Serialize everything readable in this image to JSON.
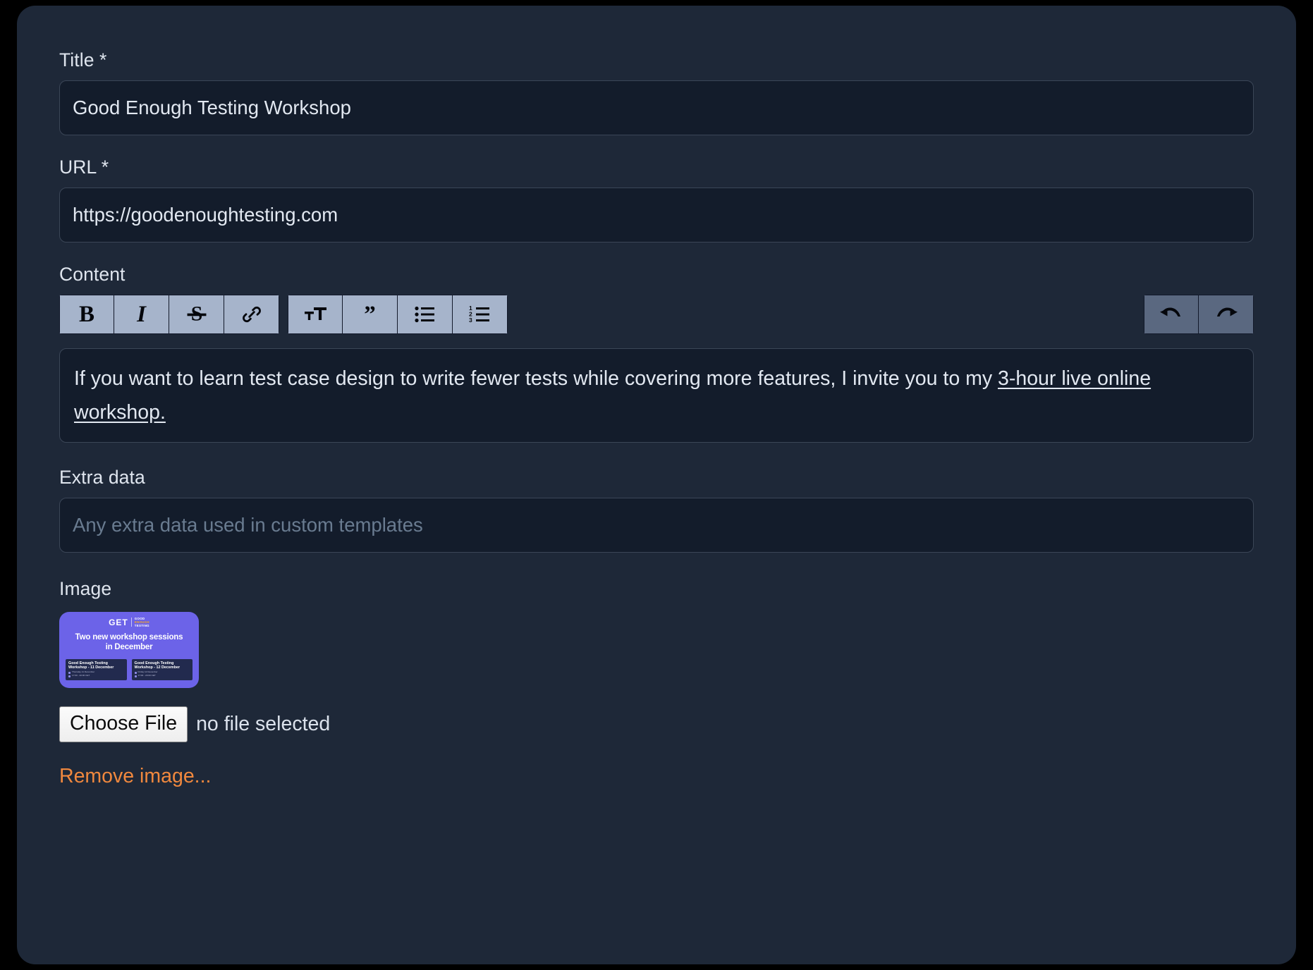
{
  "form": {
    "title_field": {
      "label": "Title *",
      "value": "Good Enough Testing Workshop"
    },
    "url_field": {
      "label": "URL *",
      "value": "https://goodenoughtesting.com"
    },
    "content_field": {
      "label": "Content",
      "text_before_link": "If you want to learn test case design to write fewer tests while covering more features, I invite you to my ",
      "link_text": "3-hour live online workshop."
    },
    "extra_data_field": {
      "label": "Extra data",
      "value": "",
      "placeholder": "Any extra data used in custom templates"
    },
    "image_field": {
      "label": "Image",
      "choose_file_label": "Choose File",
      "file_status": "no file selected",
      "remove_link": "Remove image..."
    }
  },
  "toolbar": {
    "groups": [
      {
        "name": "format",
        "buttons": [
          {
            "icon": "bold-icon",
            "glyph": "B",
            "title": "Bold"
          },
          {
            "icon": "italic-icon",
            "glyph": "I",
            "title": "Italic"
          },
          {
            "icon": "strikethrough-icon",
            "glyph": "S",
            "title": "Strikethrough"
          },
          {
            "icon": "link-icon",
            "glyph": "",
            "title": "Link"
          }
        ]
      },
      {
        "name": "block",
        "buttons": [
          {
            "icon": "heading-icon",
            "glyph": "",
            "title": "Heading"
          },
          {
            "icon": "blockquote-icon",
            "glyph": "",
            "title": "Quote"
          },
          {
            "icon": "bullet-list-icon",
            "glyph": "",
            "title": "Bullet list"
          },
          {
            "icon": "ordered-list-icon",
            "glyph": "",
            "title": "Numbered list"
          }
        ]
      },
      {
        "name": "history",
        "buttons": [
          {
            "icon": "undo-icon",
            "glyph": "",
            "title": "Undo"
          },
          {
            "icon": "redo-icon",
            "glyph": "",
            "title": "Redo"
          }
        ]
      }
    ]
  },
  "thumbnail": {
    "logo_mark": "GET",
    "logo_line1": "GOOD",
    "logo_line2": "ENOUGH",
    "logo_line3": "TESTING",
    "headline_line1": "Two new workshop sessions",
    "headline_line2": "in December",
    "cards": [
      {
        "title": "Good Enough Testing Workshop - 11 December",
        "date": "Thursday 11 December",
        "time": "17:00 - 20:00 CET"
      },
      {
        "title": "Good Enough Testing Workshop - 12 December",
        "date": "Friday 12 December",
        "time": "17:00 - 20:00 CET"
      }
    ]
  },
  "colors": {
    "page_background": "#000000",
    "card_background": "#1e2838",
    "input_background": "#131c2b",
    "input_border": "#3b4657",
    "text": "#e2e8f1",
    "placeholder": "#697b90",
    "toolbar_button": "#a6b4cb",
    "toolbar_history_button": "#5a6880",
    "accent_link": "#f0883e",
    "thumbnail_background": "#6c63e8"
  }
}
